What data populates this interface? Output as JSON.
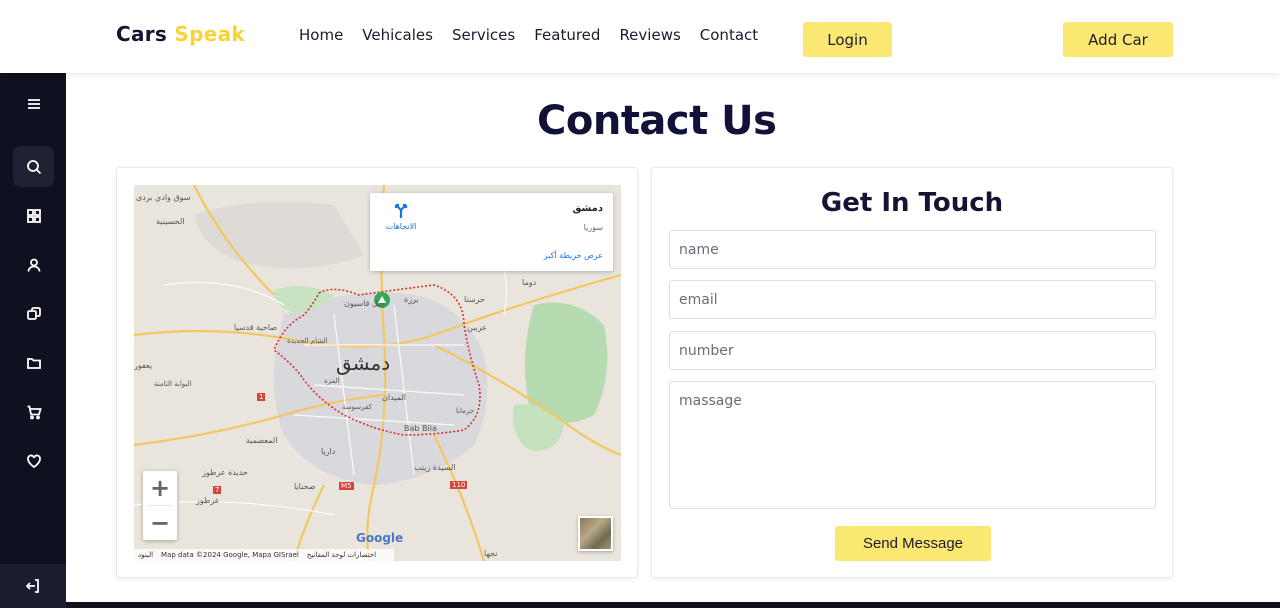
{
  "brand": {
    "name_main": "Cars",
    "name_accent": "Speak"
  },
  "nav": {
    "items": [
      "Home",
      "Vehicales",
      "Services",
      "Featured",
      "Reviews",
      "Contact"
    ],
    "login_label": "Login",
    "add_car_label": "Add Car"
  },
  "page": {
    "title": "Contact Us"
  },
  "map": {
    "place_name": "دمشق",
    "place_country": "سوريا",
    "directions_label": "الاتجاهات",
    "larger_map_label": "عرض خريطة أكبر",
    "city_label": "دمشق",
    "labels": {
      "l1": "سوق وادي بردى",
      "l2": "الحسينية",
      "l3": "جبل قاسيون",
      "l4": "برزة",
      "l5": "حرستا",
      "l6": "دوما",
      "l7": "صاحية قدسيا",
      "l8": "الشام الجديدة",
      "l9": "عربين",
      "l10": "يعفور",
      "l11": "البوابة الثامنة",
      "l12": "المزة",
      "l13": "الميدان",
      "l14": "كفرسوسة",
      "l15": "جرمانا",
      "l16": "Bab Bila",
      "l17": "المعضمية",
      "l18": "داريا",
      "l19": "السيدة زينب",
      "l20": "حديدة عرطوز",
      "l21": "صحنايا",
      "l22": "عرطوز",
      "l23": "نجها"
    },
    "footer_keyboard": "اختصارات لوحة المفاتيح",
    "footer_data": "Map data ©2024 Google, Mapa GISrael",
    "footer_terms": "البنود",
    "google_label": "Google",
    "zoom_in": "+",
    "zoom_out": "−",
    "road_m5": "M5",
    "road_110": "110",
    "road_7": "7",
    "road_1": "1"
  },
  "form": {
    "title": "Get In Touch",
    "name_placeholder": "name",
    "email_placeholder": "email",
    "number_placeholder": "number",
    "message_placeholder": "massage",
    "send_label": "Send Message"
  },
  "colors": {
    "accent": "#fbe872",
    "brand_accent": "#f7d336",
    "sidebar": "#0f1020",
    "dark_text": "#121138"
  },
  "sidebar_icons": [
    "menu-icon",
    "search-icon",
    "grid-icon",
    "user-icon",
    "copy-icon",
    "folder-icon",
    "cart-icon",
    "heart-icon",
    "logout-icon"
  ]
}
